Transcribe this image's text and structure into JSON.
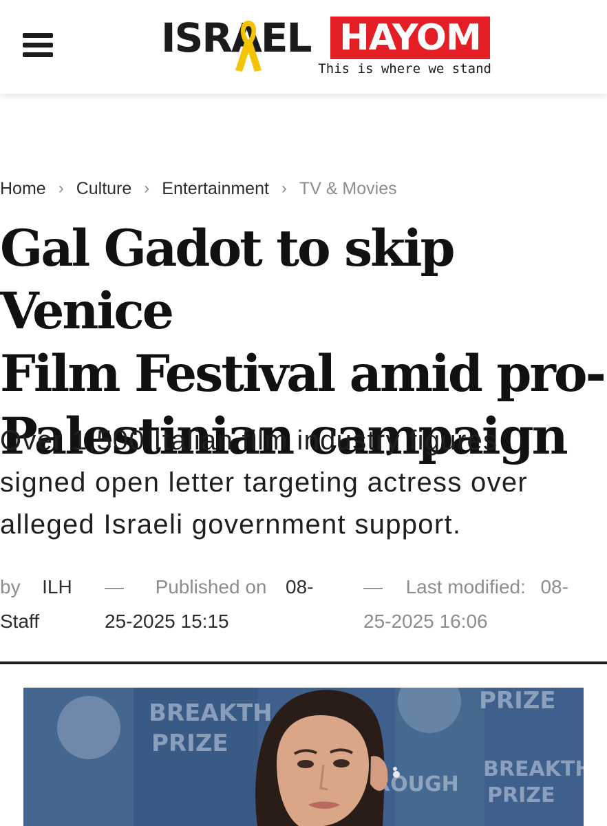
{
  "header": {
    "menu_icon": "hamburger-menu-icon",
    "logo": {
      "word_left": "ISRAEL",
      "word_right": "HAYOM",
      "tagline": "This is where we stand"
    }
  },
  "breadcrumb": {
    "items": [
      "Home",
      "Culture",
      "Entertainment",
      "TV & Movies"
    ],
    "separator_icon": "chevron-right-icon"
  },
  "article": {
    "headline_lines": [
      "Gal Gadot to skip Venice",
      "Film Festival amid pro-",
      "Palestinian campaign"
    ],
    "subheadline_lines": [
      "Over 1,500 Italian film industry figures",
      "signed open letter targeting actress over",
      "alleged Israeli government support."
    ],
    "meta": {
      "by_label": "by",
      "author_line1": "ILH",
      "author_line2": "Staff",
      "dash": "—",
      "published_label": "Published on",
      "published_line1": "08-",
      "published_line2": "25-2025 15:15",
      "modified_label": "Last modified:",
      "modified_line1": "08-",
      "modified_line2": "25-2025 16:06"
    },
    "hero_image": {
      "backdrop_text": [
        "BREAKTH",
        "PRIZE",
        "PRIZE",
        "ROUGH",
        "BREAKTHRO",
        "PRIZE"
      ]
    }
  },
  "colors": {
    "brand_red": "#e31e24",
    "ribbon_yellow": "#f5c400",
    "text_dark": "#111111",
    "text_muted": "#8d8d8d",
    "backdrop_blue": "#3f5f8c"
  }
}
